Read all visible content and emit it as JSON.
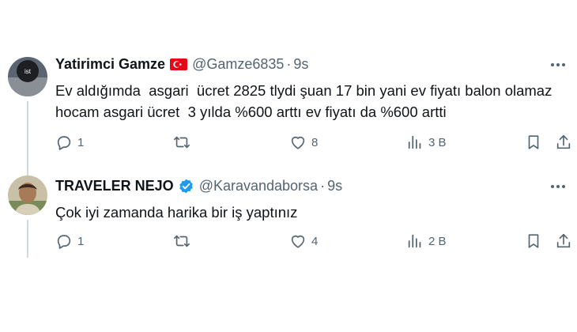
{
  "tweets": [
    {
      "display_name": "Yatirimci Gamze",
      "handle": "@Gamze6835",
      "separator": "·",
      "time": "9s",
      "text_lines": [
        "Ev aldığımda  asgari  ücret 2825 tlydi şuan 17 bin yani ev fiyatı balon olamaz",
        "hocam asgari ücret  3 yılda %600 arttı ev fiyatı da %600 artti"
      ],
      "badge_icon": "turkey-flag-icon",
      "avatar_text": "ist",
      "actions": {
        "replies": "1",
        "retweets": "",
        "likes": "8",
        "views": "3 B"
      }
    },
    {
      "display_name": "TRAVELER NEJO",
      "handle": "@Karavandaborsa",
      "separator": "·",
      "time": "9s",
      "text_lines": [
        "Çok iyi zamanda harika bir iş yaptınız"
      ],
      "badge_icon": "verified-badge-icon",
      "actions": {
        "replies": "1",
        "retweets": "",
        "likes": "4",
        "views": "2 B"
      }
    }
  ],
  "colors": {
    "text": "#0f1419",
    "secondary": "#536471",
    "verified": "#1d9bf0",
    "flag_red": "#e30a17",
    "thread_line": "#cfd9de"
  }
}
